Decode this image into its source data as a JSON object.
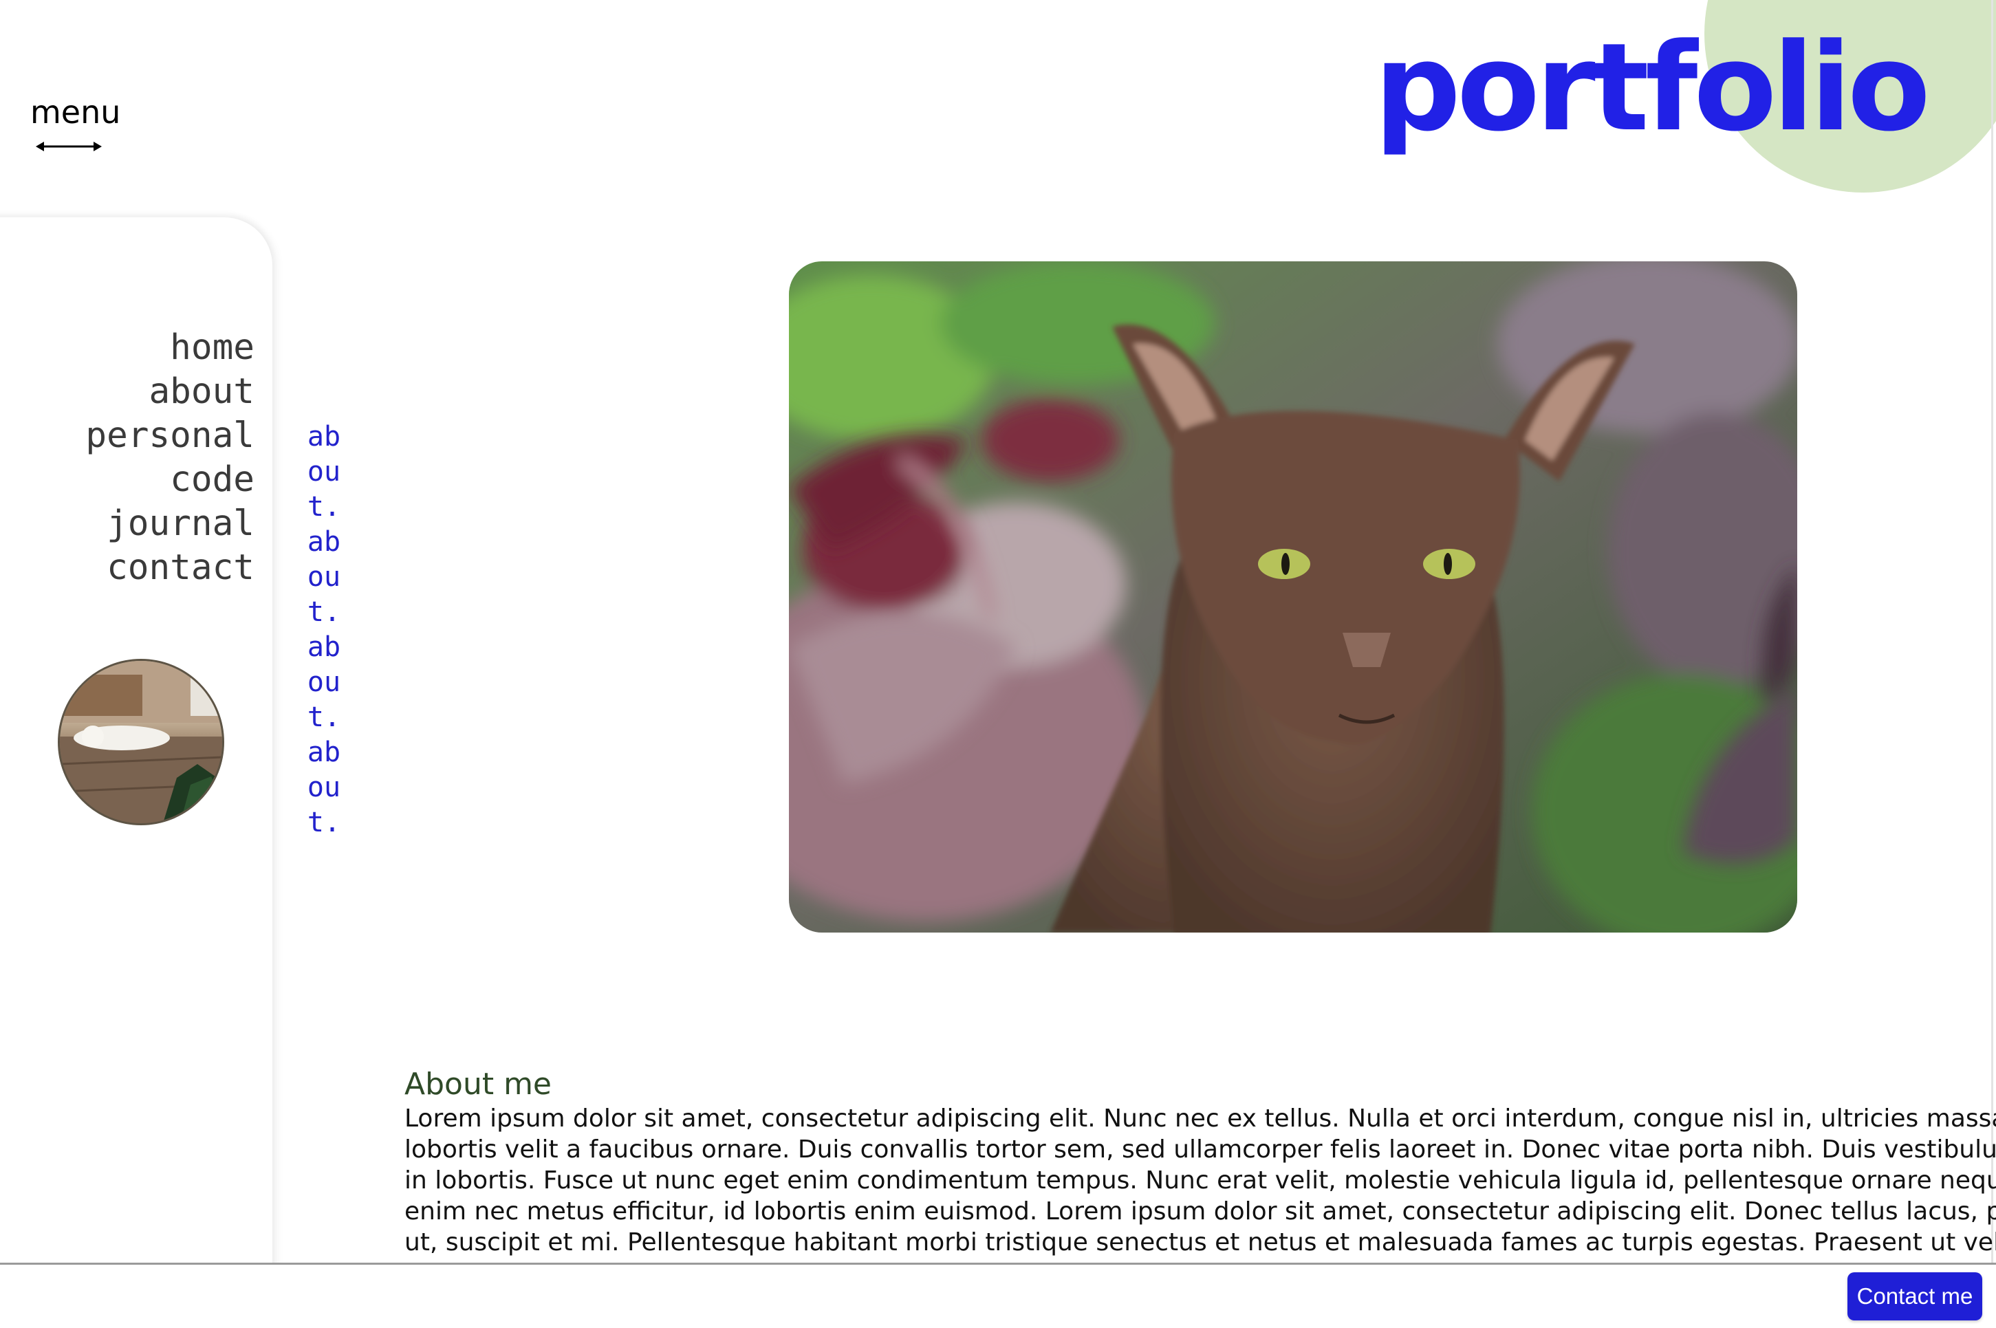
{
  "header": {
    "logo_text": "portfolio",
    "menu_label": "menu"
  },
  "nav": {
    "items": [
      {
        "label": "home"
      },
      {
        "label": "about"
      },
      {
        "label": "personal"
      },
      {
        "label": "code"
      },
      {
        "label": "journal"
      },
      {
        "label": "contact"
      }
    ]
  },
  "sidebar": {
    "vertical_text": "about.about.about.about."
  },
  "about": {
    "title": "About me",
    "body": "Lorem ipsum dolor sit amet, consectetur adipiscing elit. Nunc nec ex tellus. Nulla et orci interdum, congue nisl in, ultricies massa. Pe lobortis velit a faucibus ornare. Duis convallis tortor sem, sed ullamcorper felis laoreet in. Donec vitae porta nibh. Duis vestibulum ti in lobortis. Fusce ut nunc eget enim condimentum tempus. Nunc erat velit, molestie vehicula ligula id, pellentesque ornare neque. Q enim nec metus efficitur, id lobortis enim euismod. Lorem ipsum dolor sit amet, consectetur adipiscing elit. Donec tellus lacus, plac ut, suscipit et mi. Pellentesque habitant morbi tristique senectus et netus et malesuada fames ac turpis egestas. Praesent ut velit ic"
  },
  "footer": {
    "contact_button": "Contact me"
  },
  "colors": {
    "accent": "#2121e6",
    "deco_green": "#d5e6c4",
    "heading_green": "#2f4a28",
    "button_blue": "#1f1fd6"
  },
  "icons": {
    "menu_arrow": "double-arrow-icon"
  }
}
